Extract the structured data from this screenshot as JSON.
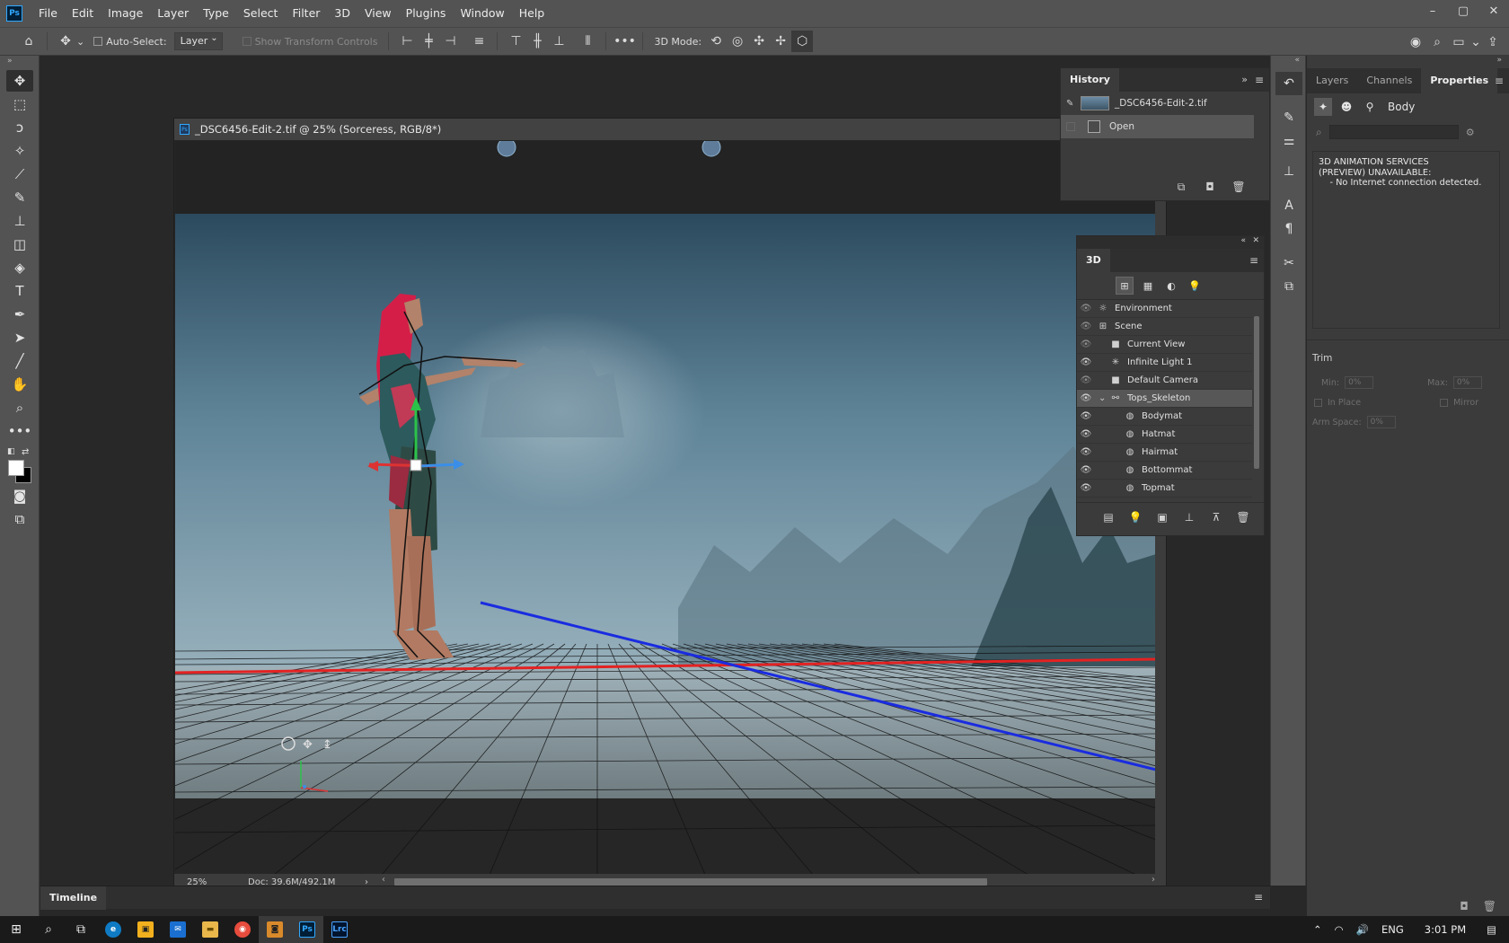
{
  "menubar": {
    "items": [
      "File",
      "Edit",
      "Image",
      "Layer",
      "Type",
      "Select",
      "Filter",
      "3D",
      "View",
      "Plugins",
      "Window",
      "Help"
    ]
  },
  "options": {
    "auto_select_label": "Auto-Select:",
    "auto_select_value": "Layer",
    "transform_controls_label": "Show Transform Controls",
    "mode_label": "3D Mode:"
  },
  "document": {
    "title": "_DSC6456-Edit-2.tif @ 25% (Sorceress, RGB/8*)",
    "zoom": "25%",
    "doc_size": "Doc: 39.6M/492.1M"
  },
  "history": {
    "tab": "History",
    "snapshot_name": "_DSC6456-Edit-2.tif",
    "steps": [
      "Open"
    ]
  },
  "panel3d": {
    "tab": "3D",
    "rows": [
      {
        "name": "Environment",
        "indent": 0,
        "icon": "environment-icon",
        "eye": "dim"
      },
      {
        "name": "Scene",
        "indent": 0,
        "icon": "scene-icon",
        "eye": "dim"
      },
      {
        "name": "Current View",
        "indent": 1,
        "icon": "camera-icon",
        "eye": "dim"
      },
      {
        "name": "Infinite Light 1",
        "indent": 1,
        "icon": "light-icon",
        "eye": "on"
      },
      {
        "name": "Default Camera",
        "indent": 1,
        "icon": "camera-icon",
        "eye": "dim"
      },
      {
        "name": "Tops_Skeleton",
        "indent": 1,
        "icon": "skeleton-icon",
        "eye": "on",
        "selected": true
      },
      {
        "name": "Bodymat",
        "indent": 2,
        "icon": "material-icon",
        "eye": "on"
      },
      {
        "name": "Hatmat",
        "indent": 2,
        "icon": "material-icon",
        "eye": "on"
      },
      {
        "name": "Hairmat",
        "indent": 2,
        "icon": "material-icon",
        "eye": "on"
      },
      {
        "name": "Bottommat",
        "indent": 2,
        "icon": "material-icon",
        "eye": "on"
      },
      {
        "name": "Topmat",
        "indent": 2,
        "icon": "material-icon",
        "eye": "on"
      }
    ]
  },
  "properties": {
    "tabs": [
      "Layers",
      "Channels",
      "Properties"
    ],
    "active_tab": "Properties",
    "mode_label": "Body",
    "message": "3D ANIMATION SERVICES\n(PREVIEW) UNAVAILABLE:\n    - No Internet connection detected.",
    "trim_title": "Trim",
    "min_label": "Min:",
    "min_value": "0%",
    "max_label": "Max:",
    "max_value": "0%",
    "in_place_label": "In Place",
    "mirror_label": "Mirror",
    "arm_space_label": "Arm Space:",
    "arm_space_value": "0%"
  },
  "timeline": {
    "label": "Timeline"
  },
  "taskbar": {
    "lang": "ENG",
    "time": "3:01 PM"
  },
  "colors": {
    "accent": "#31a8ff",
    "x_axis": "#e32222",
    "z_axis": "#1a2ce0"
  }
}
